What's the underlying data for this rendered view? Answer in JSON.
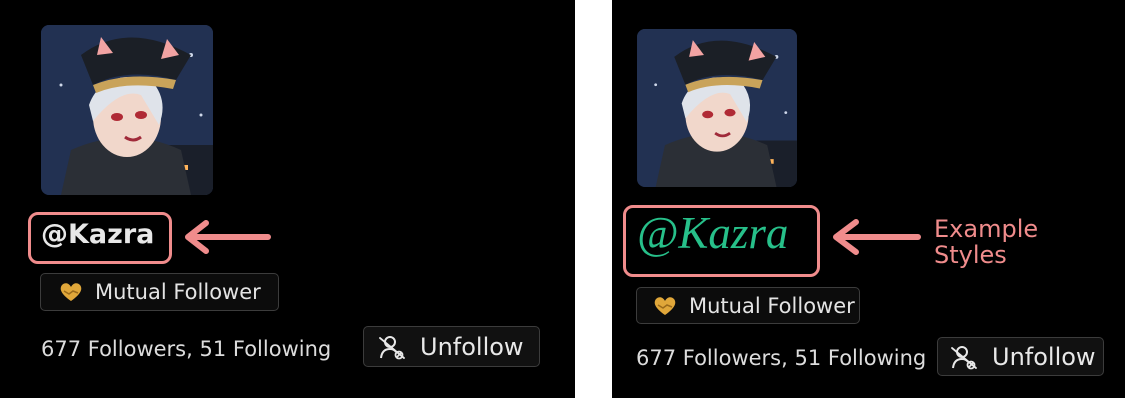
{
  "panels": [
    {
      "username": "@Kazra",
      "badge_label": "Mutual Follower",
      "follow_counts": "677 Followers, 51 Following",
      "unfollow_label": "Unfollow"
    },
    {
      "username": "@Kazra",
      "badge_label": "Mutual Follower",
      "follow_counts": "677 Followers, 51 Following",
      "unfollow_label": "Unfollow",
      "callout_line1": "Example",
      "callout_line2": "Styles"
    }
  ],
  "icons": {
    "avatar": "avatar-image",
    "badge": "handshake-heart-icon",
    "unfollow": "user-remove-icon",
    "annotation": "left-arrow-icon"
  },
  "colors": {
    "annotation": "#f08c8c",
    "styled_username": "#27c08a",
    "background": "#000000"
  }
}
